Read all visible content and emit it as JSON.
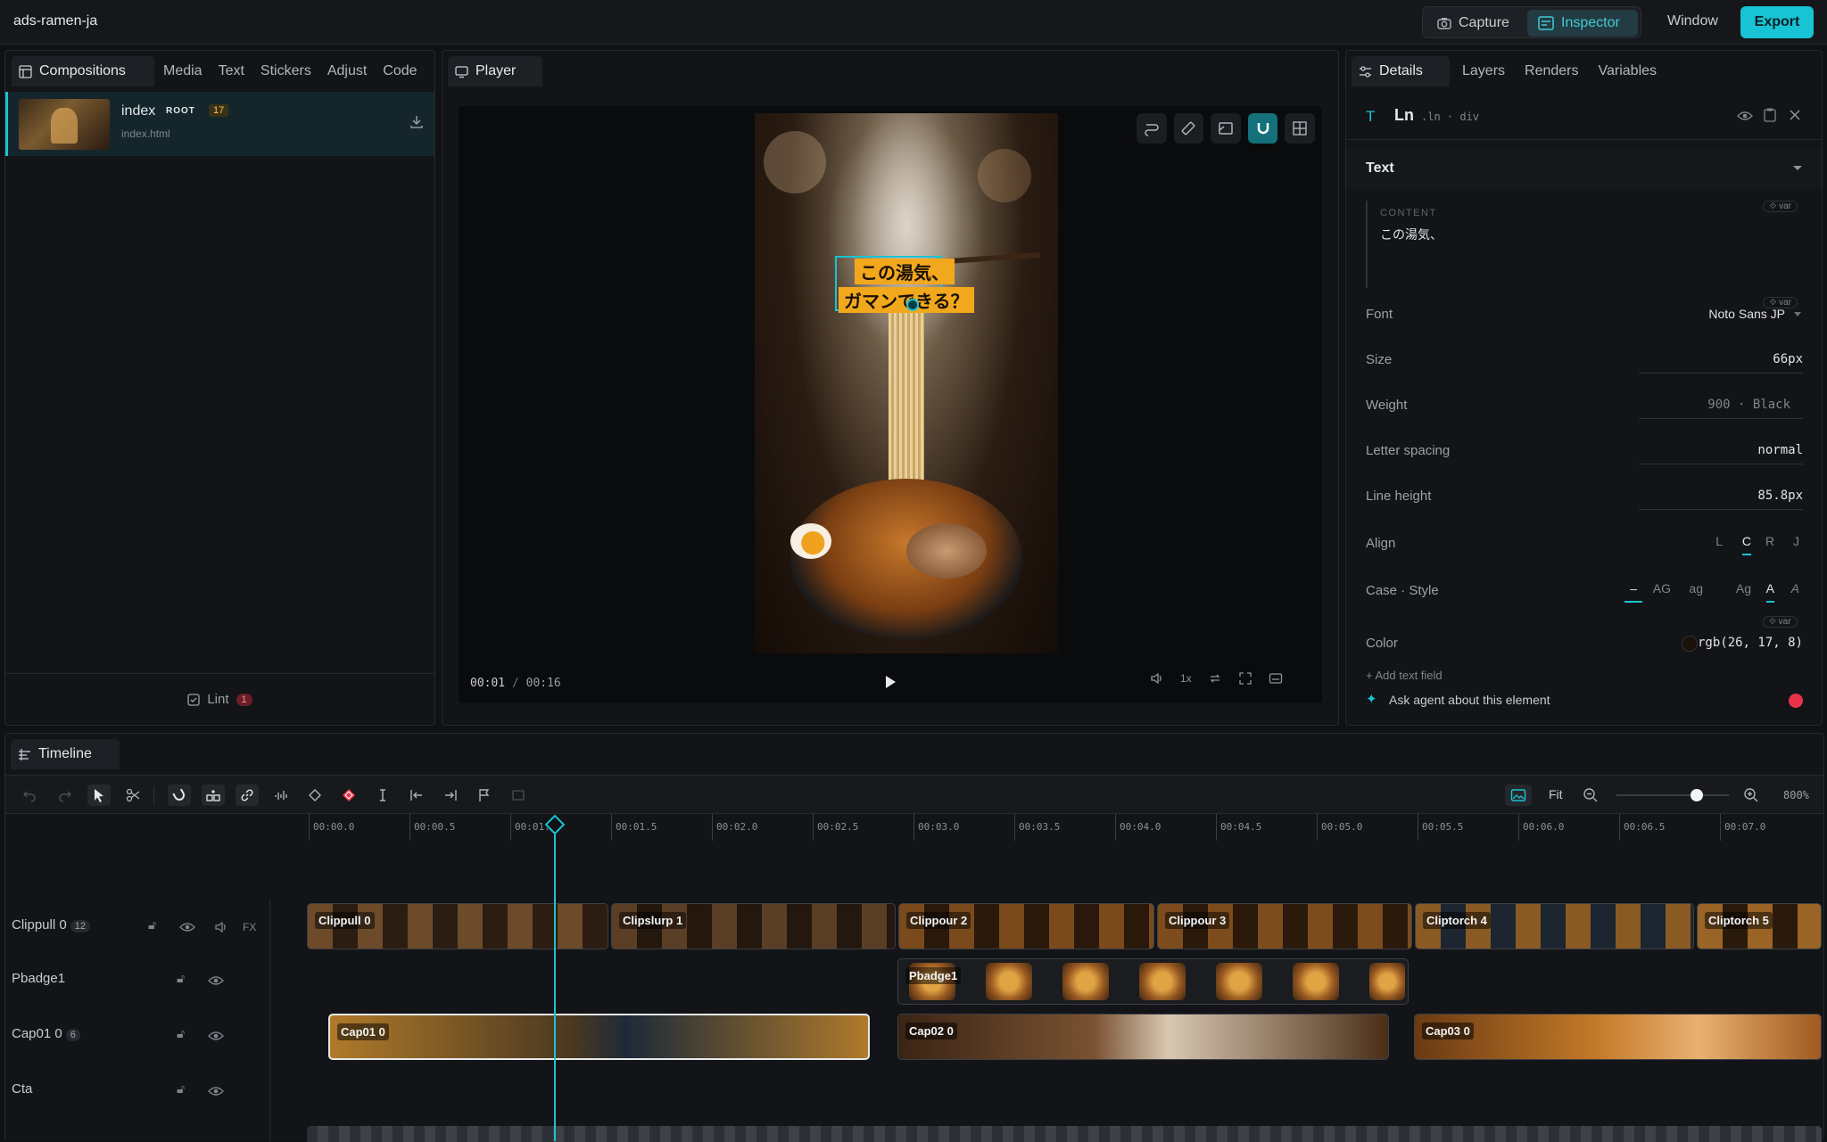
{
  "app": {
    "title": "ads-ramen-ja"
  },
  "topbar": {
    "capture": "Capture",
    "inspector": "Inspector",
    "window": "Window",
    "export": "Export"
  },
  "left": {
    "tabs": [
      "Compositions",
      "Media",
      "Text",
      "Stickers",
      "Adjust",
      "Code"
    ],
    "composition": {
      "name": "index",
      "badge": "ROOT",
      "count": "17",
      "file": "index.html"
    },
    "lint": {
      "label": "Lint",
      "count": "1"
    }
  },
  "player": {
    "tab": "Player",
    "caption_line1": "この湯気、",
    "caption_line2": "ガマンできる？",
    "time_current": "00:01",
    "time_sep": "/",
    "time_total": "00:16",
    "speed": "1x"
  },
  "details": {
    "tabs": [
      "Details",
      "Layers",
      "Renders",
      "Variables"
    ],
    "element": {
      "name": "Ln",
      "selector": ".ln · div"
    },
    "section": "Text",
    "content_label": "CONTENT",
    "content_value": "この湯気、",
    "var_chip": "⟐ var",
    "font_label": "Font",
    "font_value": "Noto Sans JP",
    "size_label": "Size",
    "size_value": "66px",
    "weight_label": "Weight",
    "weight_value": "900 · Black",
    "spacing_label": "Letter spacing",
    "spacing_value": "normal",
    "lineheight_label": "Line height",
    "lineheight_value": "85.8px",
    "align_label": "Align",
    "align_options": [
      "L",
      "C",
      "R",
      "J"
    ],
    "case_label": "Case · Style",
    "case_options": [
      "–",
      "AG",
      "ag",
      "Ag",
      "A",
      "A"
    ],
    "color_label": "Color",
    "color_value": "rgb(26, 17, 8)",
    "add_field": "+ Add text field",
    "ask_agent": "Ask agent about this element"
  },
  "timeline": {
    "tab": "Timeline",
    "fit": "Fit",
    "zoom": "800%",
    "zoom_level": 0.8,
    "ticks": [
      "00:00.0",
      "00:00.5",
      "00:01.0",
      "00:01.5",
      "00:02.0",
      "00:02.5",
      "00:03.0",
      "00:03.5",
      "00:04.0",
      "00:04.5",
      "00:05.0",
      "00:05.5",
      "00:06.0",
      "00:06.5",
      "00:07.0"
    ],
    "tracks": [
      {
        "name": "Clippull 0",
        "count": "12",
        "fx": "FX"
      },
      {
        "name": "Pbadge1"
      },
      {
        "name": "Cap01 0",
        "count": "6"
      },
      {
        "name": "Cta"
      }
    ],
    "clips_row1": [
      "Clippull 0",
      "Clipslurp 1",
      "Clippour 2",
      "Clippour 3",
      "Cliptorch 4",
      "Cliptorch 5"
    ],
    "clips_row2": [
      "Pbadge1"
    ],
    "clips_row3": [
      "Cap01 0",
      "Cap02 0",
      "Cap03 0"
    ]
  },
  "colors": {
    "accent": "#1bc3d3",
    "caption_bg": "#f2a81d",
    "danger": "#e8344a"
  }
}
